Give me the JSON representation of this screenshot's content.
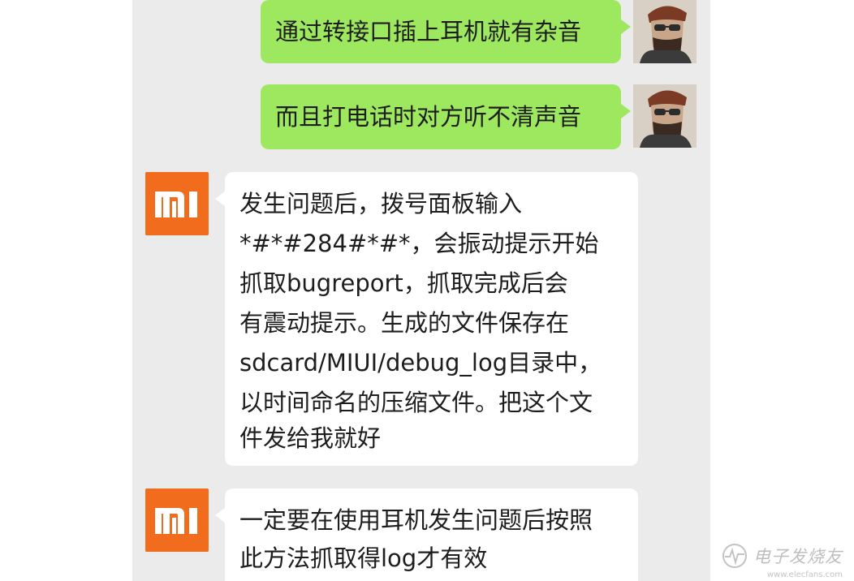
{
  "messages": [
    {
      "sender": "user",
      "lines": [
        "通过转接口插上耳机就有杂音"
      ]
    },
    {
      "sender": "user",
      "lines": [
        "而且打电话时对方听不清声音"
      ]
    },
    {
      "sender": "support",
      "lines": [
        "发生问题后，拨号面板输入",
        "*#*#284#*#*，会振动提示开始",
        "抓取bugreport，抓取完成后会",
        "有震动提示。生成的文件保存在",
        "sdcard/MIUI/debug_log目录中，",
        "以时间命名的压缩文件。把这个文",
        "件发给我就好"
      ]
    },
    {
      "sender": "support",
      "lines": [
        "一定要在使用耳机发生问题后按照",
        "此方法抓取得log才有效"
      ]
    }
  ],
  "avatars": {
    "support_logo_icon": "mi-logo-icon",
    "user_icon": "bearded-man-avatar-icon"
  },
  "watermark": {
    "text": "电子发烧友",
    "url": "www.elecfans.com"
  },
  "colors": {
    "chat_background": "#ebebeb",
    "sent_bubble": "#9ee85f",
    "received_bubble": "#ffffff",
    "mi_orange": "#f26c1d"
  }
}
